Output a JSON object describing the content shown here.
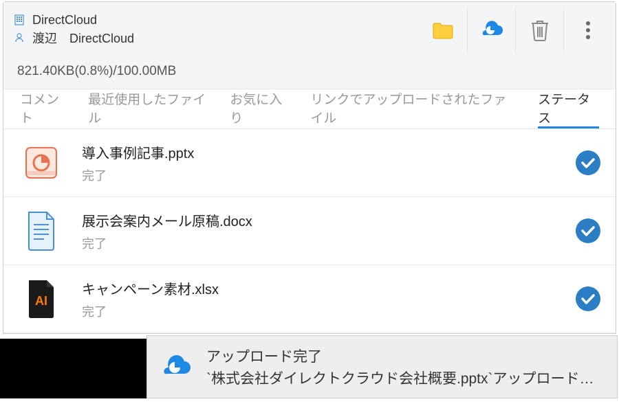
{
  "header": {
    "app_name": "DirectCloud",
    "user_line": "渡辺　DirectCloud"
  },
  "storage": {
    "text": "821.40KB(0.8%)/100.00MB"
  },
  "tabs": [
    {
      "label": "コメント",
      "active": false
    },
    {
      "label": "最近使用したファイル",
      "active": false
    },
    {
      "label": "お気に入り",
      "active": false
    },
    {
      "label": "リンクでアップロードされたファイル",
      "active": false
    },
    {
      "label": "ステータス",
      "active": true
    }
  ],
  "files": [
    {
      "name": "導入事例記事.pptx",
      "status": "完了",
      "icon": "pptx"
    },
    {
      "name": "展示会案内メール原稿.docx",
      "status": "完了",
      "icon": "docx"
    },
    {
      "name": "キャンペーン素材.xlsx",
      "status": "完了",
      "icon": "ai"
    }
  ],
  "toast": {
    "title": "アップロード完了",
    "message": "`株式会社ダイレクトクラウド会社概要.pptx`アップロード…"
  },
  "colors": {
    "brand_blue": "#1e88e5",
    "check_blue": "#2b7ec4"
  }
}
